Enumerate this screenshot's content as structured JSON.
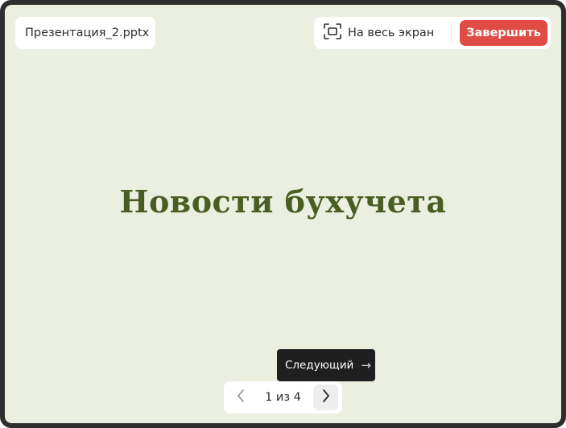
{
  "file": {
    "name": "Презентация_2.pptx"
  },
  "toolbar": {
    "fullscreen_label": "На весь экран",
    "finish_label": "Завершить"
  },
  "slide": {
    "title": "Новости бухучета"
  },
  "pager": {
    "page_label": "1 из 4",
    "next_tooltip": "Следующий"
  },
  "icons": {
    "fullscreen": "fullscreen-icon",
    "prev": "chevron-left-icon",
    "next": "chevron-right-icon",
    "tooltip_arrow": "arrow-right-icon"
  },
  "colors": {
    "slide_background": "#ebefe0",
    "title": "#4a5e24",
    "accent": "#e04b45",
    "frame": "#2e2e2e"
  }
}
